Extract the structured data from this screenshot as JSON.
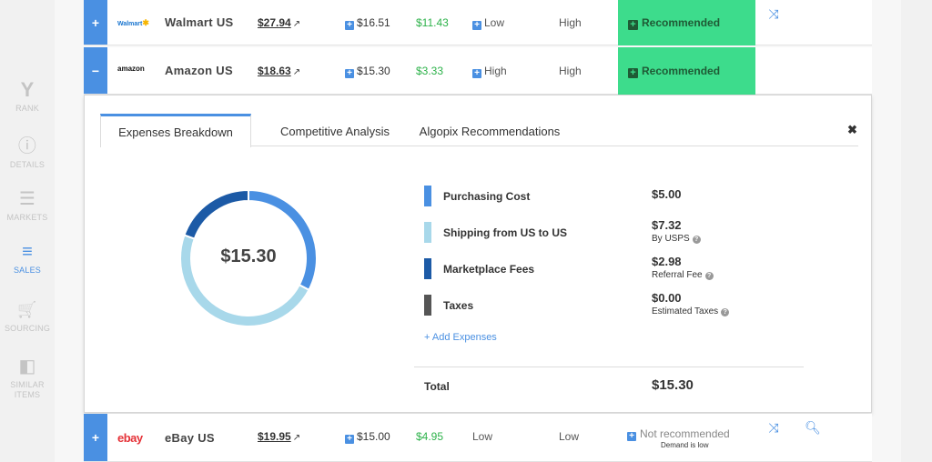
{
  "sidebar": {
    "items": [
      {
        "icon": "rank-icon",
        "glyph": "Y",
        "label": "RANK",
        "active": false
      },
      {
        "icon": "details-icon",
        "glyph": "ⓘ",
        "label": "DETAILS",
        "active": false
      },
      {
        "icon": "markets-icon",
        "glyph": "☰",
        "label": "MARKETS",
        "active": false
      },
      {
        "icon": "sales-icon",
        "glyph": "≡",
        "label": "SALES",
        "active": true
      },
      {
        "icon": "sourcing-icon",
        "glyph": "🛒",
        "label": "SOURCING",
        "active": false
      },
      {
        "icon": "similar-items-icon",
        "glyph": "◧",
        "label_line1": "SIMILAR",
        "label_line2": "ITEMS",
        "active": false
      }
    ]
  },
  "rows": [
    {
      "expander": "+",
      "logo": "Walmart",
      "logo_mark": "✱",
      "name": "Walmart US",
      "price": "$27.94",
      "cost": "$16.51",
      "profit": "$11.43",
      "competition": "Low",
      "demand": "High",
      "recommendation": "Recommended"
    },
    {
      "expander": "−",
      "logo": "amazon",
      "name": "Amazon US",
      "price": "$18.63",
      "cost": "$15.30",
      "profit": "$3.33",
      "competition": "High",
      "demand": "High",
      "recommendation": "Recommended"
    },
    {
      "expander": "+",
      "logo": "ebay",
      "name": "eBay US",
      "price": "$19.95",
      "cost": "$15.00",
      "profit": "$4.95",
      "competition": "Low",
      "demand": "Low",
      "recommendation": "Not recommended",
      "recommendation_note": "Demand is low"
    }
  ],
  "panel": {
    "tabs": [
      "Expenses Breakdown",
      "Competitive Analysis",
      "Algopix Recommendations"
    ],
    "active_tab": "Expenses Breakdown",
    "close_glyph": "✖",
    "donut_total": "$15.30",
    "expenses": [
      {
        "name": "Purchasing Cost",
        "value": "$5.00",
        "amount": 5.0,
        "note": "",
        "color": "#4a90e2"
      },
      {
        "name": "Shipping from US to US",
        "value": "$7.32",
        "amount": 7.32,
        "note": "By USPS",
        "color": "#a8d8ea"
      },
      {
        "name": "Marketplace Fees",
        "value": "$2.98",
        "amount": 2.98,
        "note": "Referral Fee",
        "color": "#1c5aa6"
      },
      {
        "name": "Taxes",
        "value": "$0.00",
        "amount": 0.0,
        "note": "Estimated Taxes",
        "color": "#555555"
      }
    ],
    "add_expenses": "+ Add Expenses",
    "total_label": "Total",
    "total_value": "$15.30"
  }
}
